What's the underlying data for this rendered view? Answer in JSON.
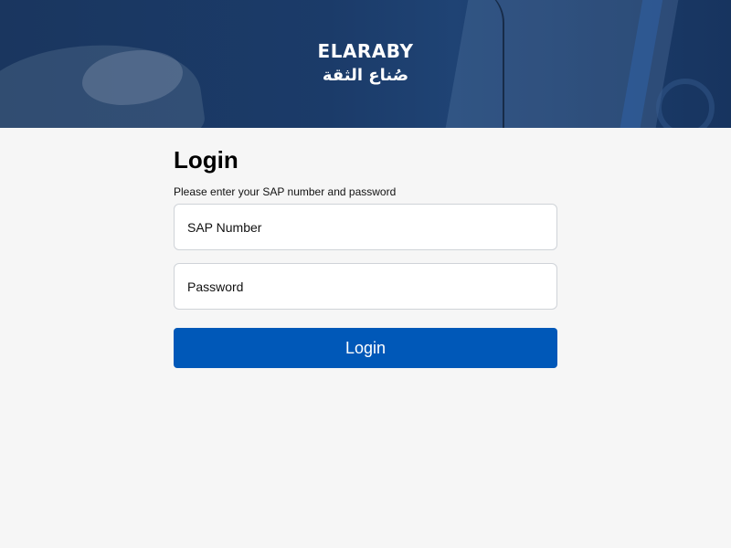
{
  "brand": {
    "english_name": "ELARABY",
    "arabic_tagline": "صُناع الثقة"
  },
  "login": {
    "title": "Login",
    "subtitle": "Please enter your SAP number and password",
    "sap_number": {
      "placeholder": "SAP Number",
      "value": ""
    },
    "password": {
      "placeholder": "Password",
      "value": ""
    },
    "button_label": "Login"
  },
  "colors": {
    "page_background": "#f6f6f6",
    "header_background": "#1b3b69",
    "primary_button": "#0058b8",
    "input_border": "#cfd3d8"
  },
  "icons": [
    "brand-logo"
  ]
}
